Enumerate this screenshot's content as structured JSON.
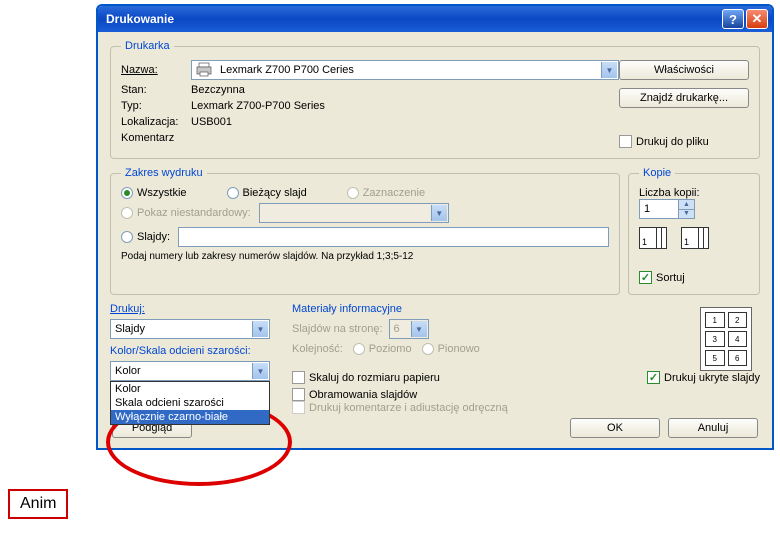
{
  "anim_label": "Anim",
  "window": {
    "title": "Drukowanie"
  },
  "printer": {
    "legend": "Drukarka",
    "name_label": "Nazwa:",
    "name_value": "Lexmark Z700 P700 Ceries",
    "status_label": "Stan:",
    "status_value": "Bezczynna",
    "type_label": "Typ:",
    "type_value": "Lexmark Z700-P700 Series",
    "where_label": "Lokalizacja:",
    "where_value": "USB001",
    "comment_label": "Komentarz",
    "properties_btn": "Właściwości",
    "find_btn": "Znajdź drukarkę...",
    "tofile_label": "Drukuj do pliku"
  },
  "range": {
    "legend": "Zakres wydruku",
    "all": "Wszystkie",
    "current": "Bieżący slajd",
    "selection": "Zaznaczenie",
    "custom": "Pokaz niestandardowy:",
    "slides": "Slajdy:",
    "hint": "Podaj numery lub zakresy numerów slajdów. Na przykład 1;3;5-12"
  },
  "copies": {
    "legend": "Kopie",
    "count_label": "Liczba kopii:",
    "count_value": "1",
    "collate": "Sortuj"
  },
  "printwhat": {
    "label": "Drukuj:",
    "value": "Slajdy",
    "color_label": "Kolor/Skala odcieni szarości:",
    "color_value": "Kolor",
    "options": [
      "Kolor",
      "Skala odcieni szarości",
      "Wyłącznie czarno-białe"
    ]
  },
  "handouts": {
    "label": "Materiały informacyjne",
    "per_page_label": "Slajdów na stronę:",
    "per_page_value": "6",
    "order_label": "Kolejność:",
    "horiz": "Poziomo",
    "vert": "Pionowo",
    "thumb_nums": [
      "1",
      "2",
      "3",
      "4",
      "5",
      "6"
    ]
  },
  "checks": {
    "scale": "Skaluj do rozmiaru papieru",
    "frame": "Obramowania slajdów",
    "comments": "Drukuj komentarze i adiustację odręczną",
    "hidden": "Drukuj ukryte slajdy"
  },
  "buttons": {
    "preview": "Podgląd",
    "ok": "OK",
    "cancel": "Anuluj"
  }
}
